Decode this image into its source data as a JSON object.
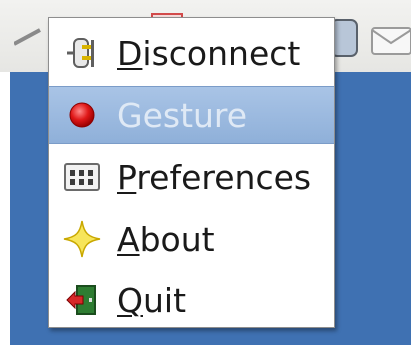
{
  "menu": {
    "items": [
      {
        "label_prefix": "",
        "mnemonic": "D",
        "label_rest": "isconnect",
        "icon": "power-plug-icon",
        "state": "normal"
      },
      {
        "label_prefix": "",
        "mnemonic": "",
        "label_rest": "Gesture",
        "icon": "red-record-icon",
        "state": "disabled-highlighted"
      },
      {
        "label_prefix": "",
        "mnemonic": "P",
        "label_rest": "references",
        "icon": "preferences-panel-icon",
        "state": "normal"
      },
      {
        "label_prefix": "",
        "mnemonic": "A",
        "label_rest": "bout",
        "icon": "star-about-icon",
        "state": "normal"
      },
      {
        "label_prefix": "",
        "mnemonic": "Q",
        "label_rest": "uit",
        "icon": "exit-door-icon",
        "state": "normal"
      }
    ]
  },
  "colors": {
    "desktop": "#3f71b2",
    "highlight": "#9bb9e0",
    "menu_border": "#8e8e8e"
  }
}
